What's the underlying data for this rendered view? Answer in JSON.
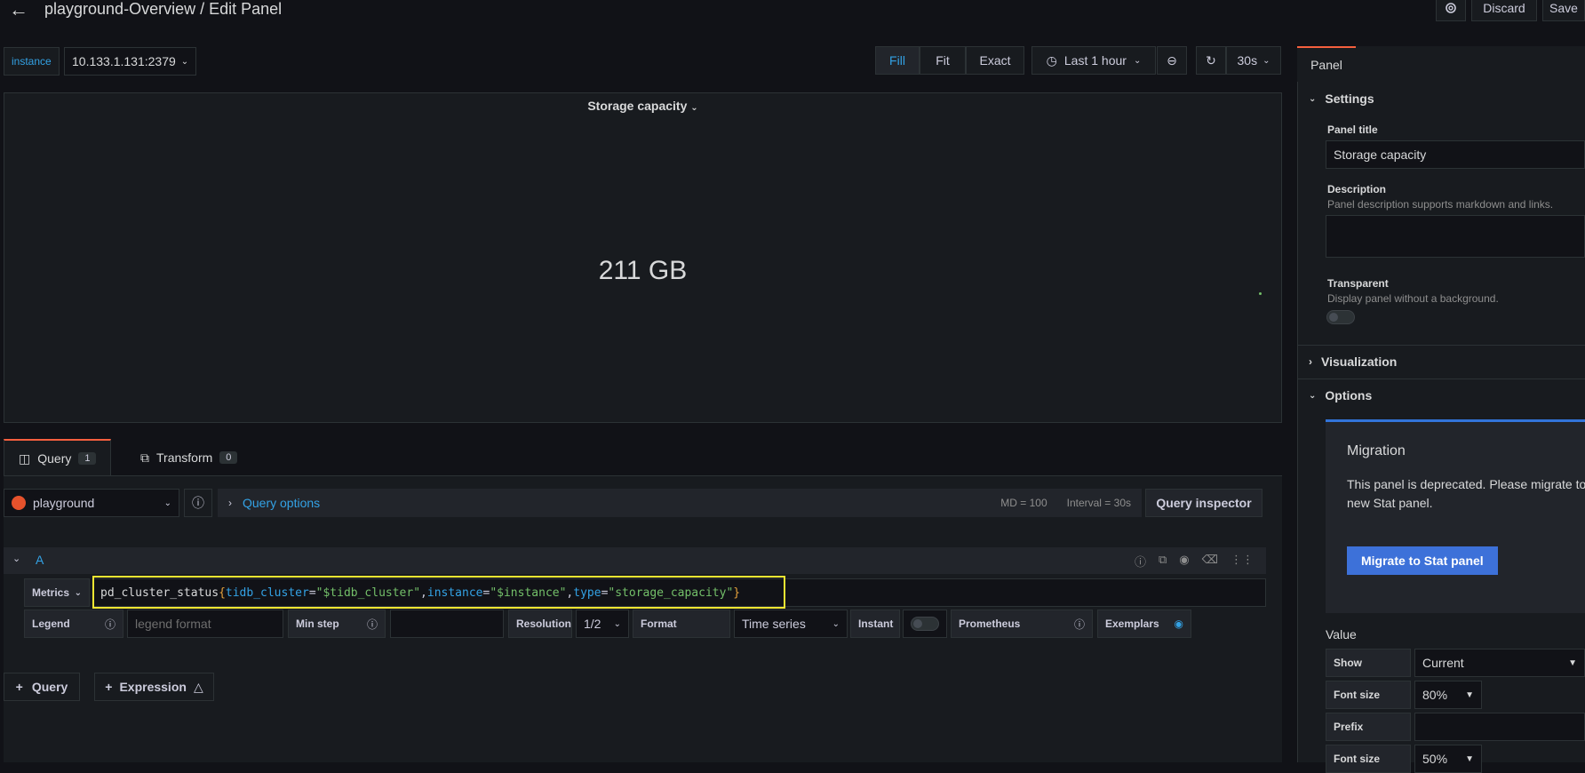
{
  "header": {
    "title": "playground-Overview / Edit Panel",
    "discard_label": "Discard",
    "save_label": "Save"
  },
  "variables": {
    "instance_label": "instance",
    "instance_value": "10.133.1.131:2379"
  },
  "toolbar": {
    "fill_label": "Fill",
    "fit_label": "Fit",
    "exact_label": "Exact",
    "time_range": "Last 1 hour",
    "refresh_interval": "30s"
  },
  "panel": {
    "title": "Storage capacity",
    "value": "211 GB"
  },
  "tabs": {
    "query_label": "Query",
    "query_count": "1",
    "transform_label": "Transform",
    "transform_count": "0"
  },
  "datasource": {
    "name": "playground",
    "query_options_label": "Query options",
    "md": "MD = 100",
    "interval": "Interval = 30s",
    "inspector_label": "Query inspector"
  },
  "query_a": {
    "ref": "A",
    "metrics_label": "Metrics",
    "expr_metric": "pd_cluster_status",
    "expr_open": "{",
    "expr_k1": "tidb_cluster",
    "expr_v1": "\"$tidb_cluster\"",
    "expr_k2": "instance",
    "expr_v2": "\"$instance\"",
    "expr_k3": "type",
    "expr_v3": "\"storage_capacity\"",
    "expr_close": "}",
    "legend_label": "Legend",
    "legend_placeholder": "legend format",
    "min_step_label": "Min step",
    "resolution_label": "Resolution",
    "resolution_value": "1/2",
    "format_label": "Format",
    "format_value": "Time series",
    "instant_label": "Instant",
    "prometheus_label": "Prometheus",
    "exemplars_label": "Exemplars"
  },
  "add": {
    "query_label": "Query",
    "expression_label": "Expression"
  },
  "sidebar": {
    "tab_label": "Panel",
    "settings_label": "Settings",
    "panel_title_label": "Panel title",
    "panel_title_value": "Storage capacity",
    "description_label": "Description",
    "description_hint": "Panel description supports markdown and links.",
    "transparent_label": "Transparent",
    "transparent_hint": "Display panel without a background.",
    "visualization_label": "Visualization",
    "options_label": "Options",
    "migration_title": "Migration",
    "migration_text": "This panel is deprecated. Please migrate to the new Stat panel.",
    "migration_text_1": "This panel is deprecated. Please migrate to",
    "migration_text_2": "new Stat panel.",
    "migrate_button": "Migrate to Stat panel",
    "value_label": "Value",
    "show_label": "Show",
    "show_value": "Current",
    "font_size_label": "Font size",
    "font_size_value": "80%",
    "prefix_label": "Prefix",
    "font_size2_label": "Font size",
    "font_size2_value": "50%"
  },
  "colors": {
    "accent": "#33a2e5",
    "tab_active": "#f55f3e",
    "highlight_box": "#f2e632",
    "migrate_blue": "#3d71d9"
  }
}
